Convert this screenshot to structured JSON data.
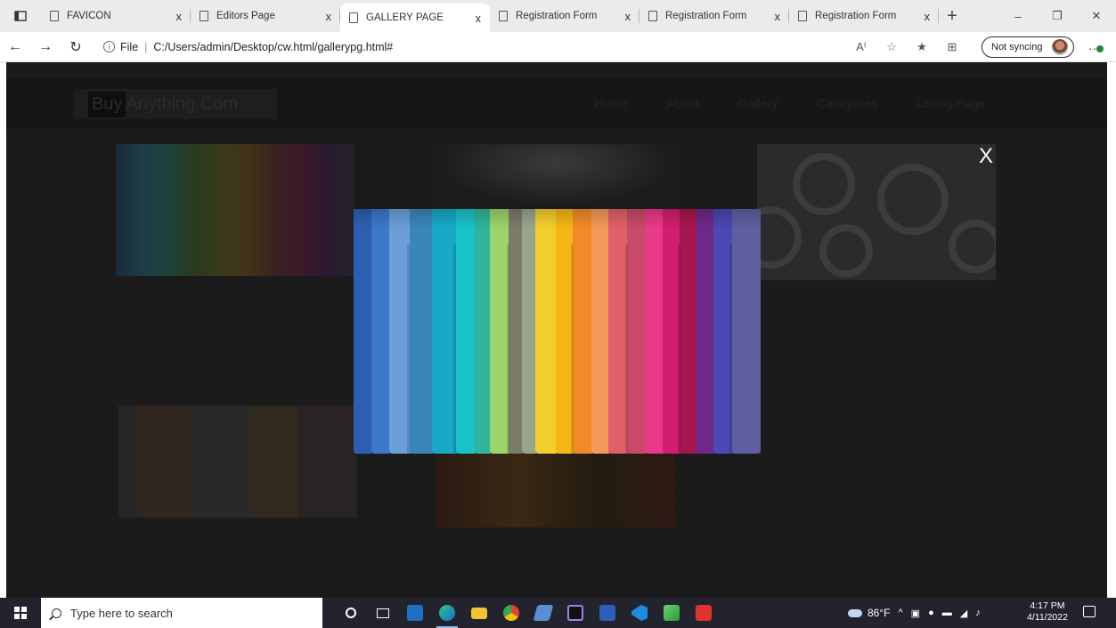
{
  "browser": {
    "tabs": [
      {
        "title": "FAVICON",
        "active": false
      },
      {
        "title": "Editors Page",
        "active": false
      },
      {
        "title": "GALLERY PAGE",
        "active": true
      },
      {
        "title": "Registration Form",
        "active": false
      },
      {
        "title": "Registration Form",
        "active": false
      },
      {
        "title": "Registration Form",
        "active": false
      }
    ],
    "tab_close": "x",
    "new_tab": "+",
    "url_scheme": "File",
    "url": "C:/Users/admin/Desktop/cw.html/gallerypg.html#",
    "sync_label": "Not syncing"
  },
  "site": {
    "brand_buy": "Buy",
    "brand_rest": "Anything.Com",
    "menu": [
      "Home",
      "About",
      "Gallery",
      "Categories",
      "Listing Page"
    ]
  },
  "lightbox": {
    "close_label": "X",
    "image_subject": "colorful t-shirts on hangers"
  },
  "taskbar": {
    "search_placeholder": "Type here to search",
    "temperature": "86°F",
    "time": "4:17 PM",
    "date": "4/11/2022"
  },
  "colors": {
    "overlay": "#1b1b1b",
    "tabstrip": "#ebebeb",
    "taskbar": "#23232e"
  }
}
